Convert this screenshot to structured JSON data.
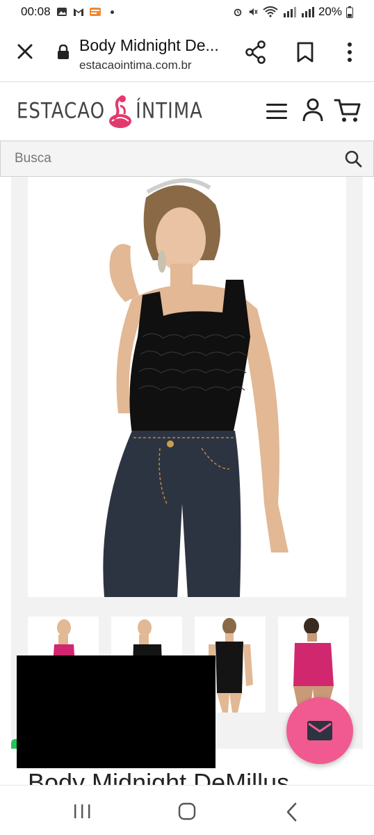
{
  "status_bar": {
    "time": "00:08",
    "battery": "20%"
  },
  "browser": {
    "page_title": "Body Midnight De...",
    "url": "estacaointima.com.br"
  },
  "site": {
    "logo_left": "ESTACAO",
    "logo_right": "ÍNTIMA"
  },
  "search": {
    "placeholder": "Busca"
  },
  "product": {
    "title": "Body Midnight DeMillus"
  },
  "colors": {
    "accent": "#f05a91",
    "whatsapp": "#25c559",
    "body_black": "#101010",
    "denim": "#2d3441"
  },
  "icons": [
    "close-icon",
    "lock-icon",
    "share-icon",
    "bookmark-icon",
    "more-icon",
    "menu-icon",
    "user-icon",
    "cart-icon",
    "search-icon",
    "mail-icon",
    "recent-apps-icon",
    "home-icon",
    "back-icon"
  ]
}
